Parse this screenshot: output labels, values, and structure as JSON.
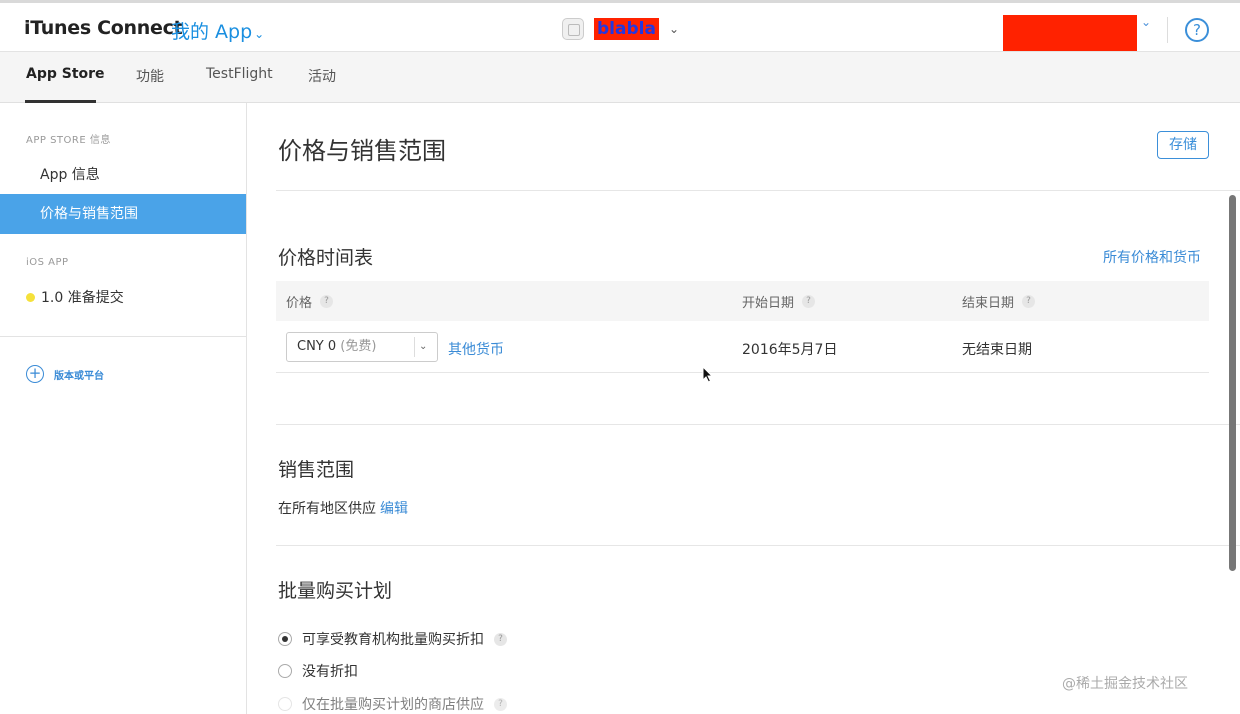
{
  "header": {
    "brand": "iTunes Connect",
    "my_apps": "我的 App",
    "app_name": "blabla",
    "help": "?"
  },
  "tabs": [
    {
      "label": "App Store",
      "active": true
    },
    {
      "label": "功能"
    },
    {
      "label": "TestFlight"
    },
    {
      "label": "活动"
    }
  ],
  "sidebar": {
    "section_app_store": "APP STORE 信息",
    "items": [
      {
        "label": "App 信息"
      },
      {
        "label": "价格与销售范围",
        "active": true
      }
    ],
    "section_ios": "iOS APP",
    "version_status": "1.0 准备提交",
    "add_version": "版本或平台"
  },
  "main": {
    "title": "价格与销售范围",
    "save_label": "存储",
    "price_schedule": {
      "title": "价格时间表",
      "all_prices_link": "所有价格和货币",
      "columns": {
        "price": "价格",
        "start_date": "开始日期",
        "end_date": "结束日期"
      },
      "row": {
        "price_value": "CNY 0",
        "price_note": "(免费)",
        "other_currency_link": "其他货币",
        "start_date": "2016年5月7日",
        "end_date": "无结束日期"
      }
    },
    "availability": {
      "title": "销售范围",
      "text": "在所有地区供应",
      "edit_link": "编辑"
    },
    "volume_purchase": {
      "title": "批量购买计划",
      "options": [
        {
          "label": "可享受教育机构批量购买折扣",
          "checked": true,
          "help": true
        },
        {
          "label": "没有折扣",
          "checked": false,
          "help": false
        },
        {
          "label": "仅在批量购买计划的商店供应",
          "checked": false,
          "help": true
        }
      ]
    }
  },
  "watermark": "@稀土掘金技术社区",
  "colors": {
    "accent": "#3a8bd6",
    "sidebar_active": "#4aa3e8",
    "redaction": "#ff2200",
    "status_dot": "#f5e13b"
  }
}
